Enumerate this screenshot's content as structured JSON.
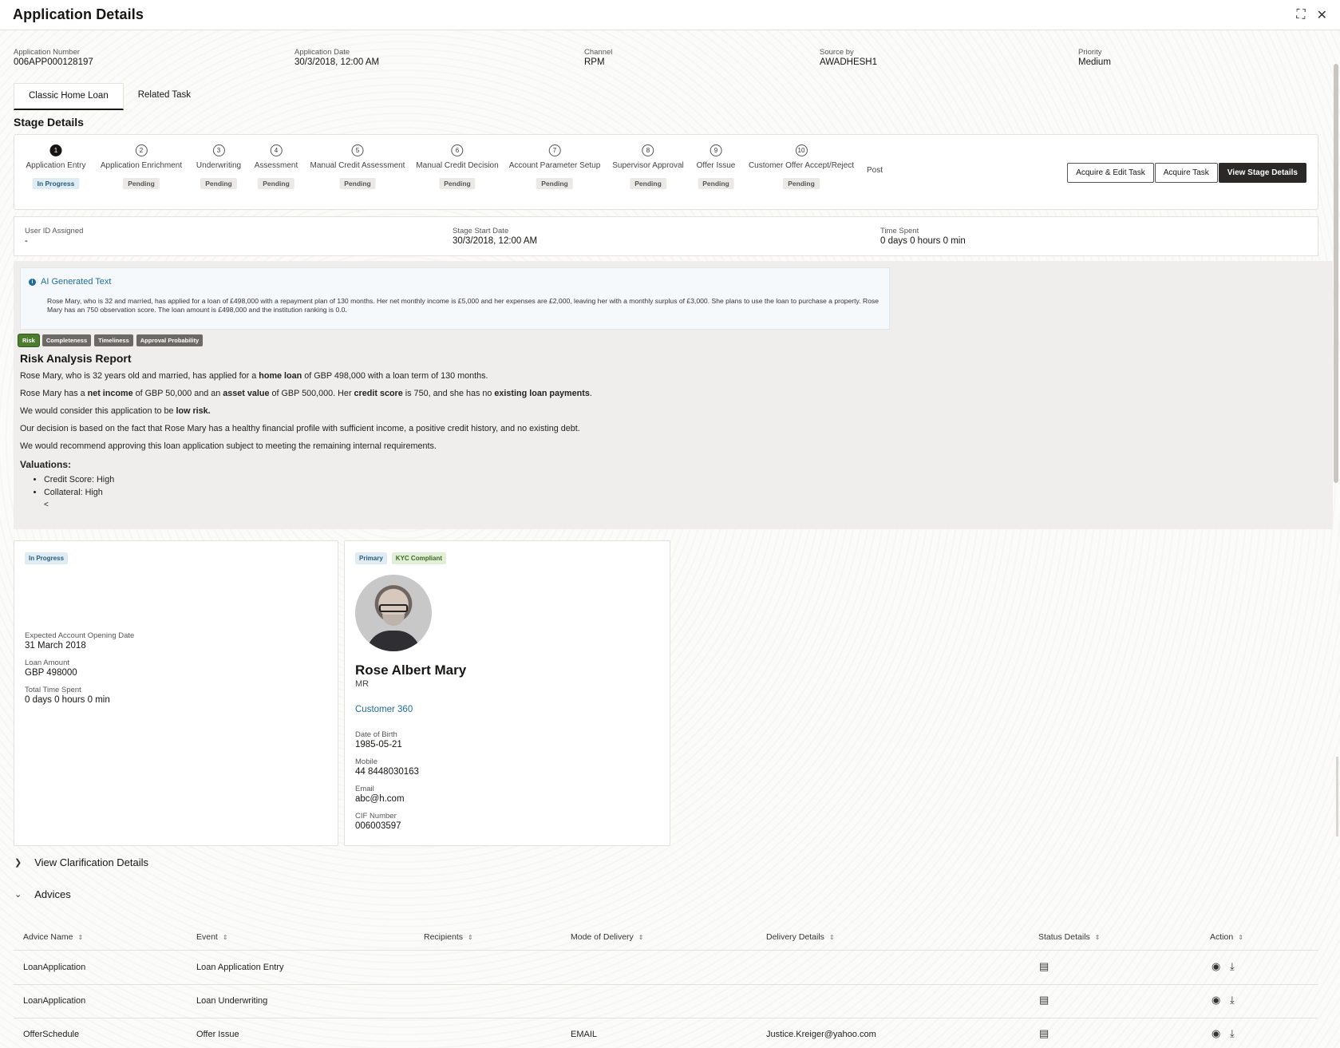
{
  "header": {
    "title": "Application Details",
    "collapse_icon": "⛶",
    "close_icon": "✕"
  },
  "meta": [
    {
      "label": "Application Number",
      "value": "006APP000128197"
    },
    {
      "label": "Application Date",
      "value": "30/3/2018, 12:00 AM"
    },
    {
      "label": "Channel",
      "value": "RPM"
    },
    {
      "label": "Source by",
      "value": "AWADHESH1"
    },
    {
      "label": "Priority",
      "value": "Medium"
    }
  ],
  "tabs": [
    {
      "label": "Classic Home Loan"
    },
    {
      "label": "Related Task"
    }
  ],
  "stage_details": {
    "title": "Stage Details",
    "stages": [
      {
        "num": "1",
        "name": "Application Entry",
        "status": "In Progress"
      },
      {
        "num": "2",
        "name": "Application Enrichment",
        "status": "Pending"
      },
      {
        "num": "3",
        "name": "Underwriting",
        "status": "Pending"
      },
      {
        "num": "4",
        "name": "Assessment",
        "status": "Pending"
      },
      {
        "num": "5",
        "name": "Manual Credit Assessment",
        "status": "Pending"
      },
      {
        "num": "6",
        "name": "Manual Credit Decision",
        "status": "Pending"
      },
      {
        "num": "7",
        "name": "Account Parameter Setup",
        "status": "Pending"
      },
      {
        "num": "8",
        "name": "Supervisor Approval",
        "status": "Pending"
      },
      {
        "num": "9",
        "name": "Offer Issue",
        "status": "Pending"
      },
      {
        "num": "10",
        "name": "Customer Offer Accept/Reject",
        "status": "Pending"
      },
      {
        "num": "",
        "name": "Post",
        "status": ""
      }
    ],
    "buttons": {
      "acquire_edit": "Acquire & Edit Task",
      "acquire": "Acquire Task",
      "view_stage": "View Stage Details"
    }
  },
  "stage_info": [
    {
      "label": "User ID Assigned",
      "value": "-"
    },
    {
      "label": "Stage Start Date",
      "value": "30/3/2018, 12:00 AM"
    },
    {
      "label": "Time Spent",
      "value": "0 days 0 hours 0 min"
    }
  ],
  "ai": {
    "heading": "AI Generated Text",
    "text": "Rose Mary, who is 32 and married, has applied for a loan of £498,000 with a repayment plan of 130 months. Her net monthly income is £5,000 and her expenses are £2,000, leaving her with a monthly surplus of £3,000. She plans to use the loan to purchase a property. Rose Mary has an 750 observation score. The loan amount is £498,000 and the institution ranking is 0.0.",
    "pills": [
      "Risk",
      "Completeness",
      "Timeliness",
      "Approval Probability"
    ],
    "report": {
      "title": "Risk Analysis Report",
      "p1": [
        "Rose Mary, who is 32 years old and married, has applied for a ",
        "home loan",
        " of GBP 498,000 with a loan term of 130 months."
      ],
      "p2": [
        "Rose Mary has a ",
        "net income",
        " of GBP 50,000 and an ",
        "asset value",
        " of GBP 500,000. Her ",
        "credit score",
        " is 750, and she has no ",
        "existing loan payments",
        "."
      ],
      "p3": [
        "We would consider this application to be ",
        "low risk."
      ],
      "p4": "Our decision is based on the fact that Rose Mary has a healthy financial profile with sufficient income, a positive credit history, and no existing debt.",
      "p5": "We would recommend approving this loan application subject to meeting the remaining internal requirements.",
      "valuations_title": "Valuations:",
      "valuations": [
        "Credit Score: High",
        "Collateral: High"
      ],
      "trailing": "<"
    }
  },
  "loan_card": {
    "status": "In Progress",
    "fields": [
      {
        "label": "Expected Account Opening Date",
        "value": "31 March 2018"
      },
      {
        "label": "Loan Amount",
        "value": "GBP 498000"
      },
      {
        "label": "Total Time Spent",
        "value": "0 days 0 hours 0 min"
      }
    ]
  },
  "customer_card": {
    "tags": [
      "Primary",
      "KYC Compliant"
    ],
    "name": "Rose Albert Mary",
    "title": "MR",
    "link": "Customer 360",
    "fields": [
      {
        "label": "Date of Birth",
        "value": "1985-05-21"
      },
      {
        "label": "Mobile",
        "value": "44 8448030163"
      },
      {
        "label": "Email",
        "value": "abc@h.com"
      },
      {
        "label": "CIF Number",
        "value": "006003597"
      }
    ]
  },
  "sections": {
    "clarification": "View Clarification Details",
    "advices": "Advices"
  },
  "advices_table": {
    "columns": [
      "Advice Name",
      "Event",
      "Recipients",
      "Mode of Delivery",
      "Delivery Details",
      "Status Details",
      "Action"
    ],
    "rows": [
      {
        "name": "LoanApplication",
        "event": "Loan Application Entry",
        "recipients": "",
        "mode": "",
        "details": ""
      },
      {
        "name": "LoanApplication",
        "event": "Loan Underwriting",
        "recipients": "",
        "mode": "",
        "details": ""
      },
      {
        "name": "OfferSchedule",
        "event": "Offer Issue",
        "recipients": "",
        "mode": "EMAIL",
        "details": "Justice.Kreiger@yahoo.com"
      }
    ]
  }
}
